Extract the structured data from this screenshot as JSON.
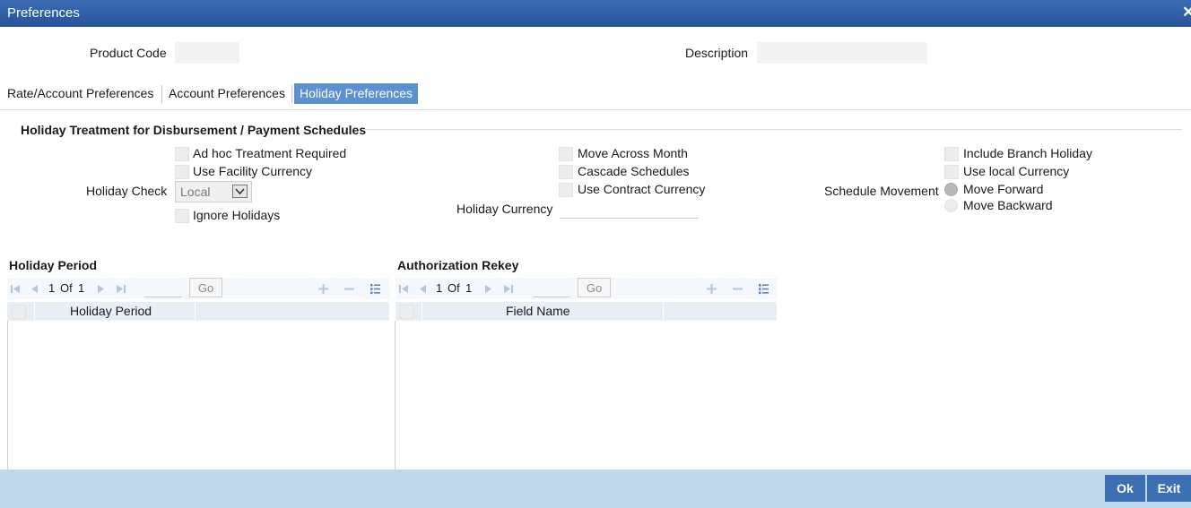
{
  "window": {
    "title": "Preferences",
    "close_symbol": "✕"
  },
  "header": {
    "product_code_label": "Product Code",
    "product_code_value": "",
    "description_label": "Description",
    "description_value": ""
  },
  "tabs": [
    {
      "label": "Rate/Account Preferences",
      "active": false
    },
    {
      "label": "Account Preferences",
      "active": false
    },
    {
      "label": "Holiday Preferences",
      "active": true
    }
  ],
  "section": {
    "title": "Holiday Treatment for Disbursement / Payment Schedules",
    "left": {
      "adhoc_label": "Ad hoc Treatment Required",
      "facility_currency_label": "Use Facility Currency",
      "holiday_check_label": "Holiday Check",
      "holiday_check_value": "Local",
      "ignore_holidays_label": "Ignore Holidays"
    },
    "middle": {
      "move_across_month_label": "Move Across Month",
      "cascade_schedules_label": "Cascade Schedules",
      "contract_currency_label": "Use Contract Currency",
      "holiday_currency_label": "Holiday Currency",
      "holiday_currency_value": ""
    },
    "right": {
      "include_branch_holiday_label": "Include Branch Holiday",
      "local_currency_label": "Use local Currency",
      "schedule_movement_label": "Schedule Movement",
      "move_forward_label": "Move Forward",
      "move_backward_label": "Move Backward",
      "selected_movement": "Move Forward"
    }
  },
  "holiday_period": {
    "title": "Holiday Period",
    "page_current": "1",
    "page_of": "Of",
    "page_total": "1",
    "go_label": "Go",
    "columns": [
      "Holiday Period"
    ],
    "rows": []
  },
  "authorization_rekey": {
    "title": "Authorization Rekey",
    "page_current": "1",
    "page_of": "Of",
    "page_total": "1",
    "go_label": "Go",
    "columns": [
      "Field Name"
    ],
    "rows": []
  },
  "footer": {
    "ok_label": "Ok",
    "exit_label": "Exit"
  },
  "colors": {
    "title_bar": "#2f5fa8",
    "active_tab": "#5b90d3",
    "footer": "#bfd8ec",
    "button": "#3d6fb3"
  }
}
